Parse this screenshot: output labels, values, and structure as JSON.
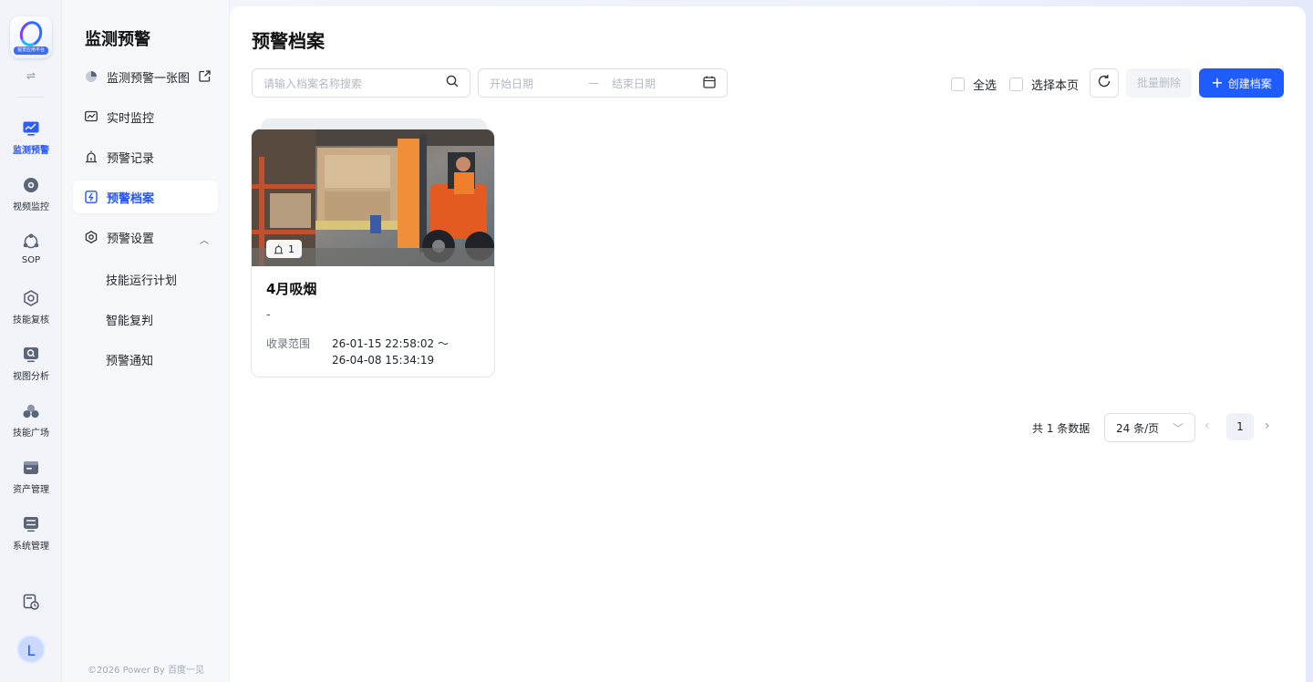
{
  "logo": {
    "tag": "视觉应用平台"
  },
  "rail": {
    "items": [
      {
        "label": "监测预警",
        "icon": "monitor-chart-icon",
        "active": true
      },
      {
        "label": "视频监控",
        "icon": "camera-icon"
      },
      {
        "label": "SOP",
        "icon": "sop-nodes-icon"
      },
      {
        "label": "技能复核",
        "icon": "hexagon-target-icon"
      },
      {
        "label": "视图分析",
        "icon": "view-search-icon"
      },
      {
        "label": "技能广场",
        "icon": "skill-cluster-icon"
      },
      {
        "label": "资产管理",
        "icon": "asset-folder-icon"
      },
      {
        "label": "系统管理",
        "icon": "system-settings-icon"
      }
    ],
    "avatar_letter": "L"
  },
  "submenu": {
    "title": "监测预警",
    "items": [
      {
        "label": "监测预警一张图"
      },
      {
        "label": "实时监控"
      },
      {
        "label": "预警记录"
      },
      {
        "label": "预警档案"
      },
      {
        "label": "预警设置"
      }
    ],
    "children": [
      {
        "label": "技能运行计划"
      },
      {
        "label": "智能复判"
      },
      {
        "label": "预警通知"
      }
    ],
    "copyright": "©2026 Power By 百度一见"
  },
  "main": {
    "title": "预警档案",
    "search_placeholder": "请输入档案名称搜索",
    "date_start_placeholder": "开始日期",
    "date_separator": "—",
    "date_end_placeholder": "结束日期",
    "select_all": "全选",
    "select_page": "选择本页",
    "batch_delete": "批量删除",
    "create": "创建档案"
  },
  "card": {
    "alert_count": "1",
    "title": "4月吸烟",
    "description": "-",
    "range_label": "收录范围",
    "range_start": "26-01-15 22:58:02 ～",
    "range_end": "26-04-08 15:34:19"
  },
  "pagination": {
    "total": "共 1 条数据",
    "page_size": "24 条/页",
    "current_page": "1"
  },
  "colors": {
    "primary": "#1f5cff",
    "active_text": "#2454ff"
  }
}
